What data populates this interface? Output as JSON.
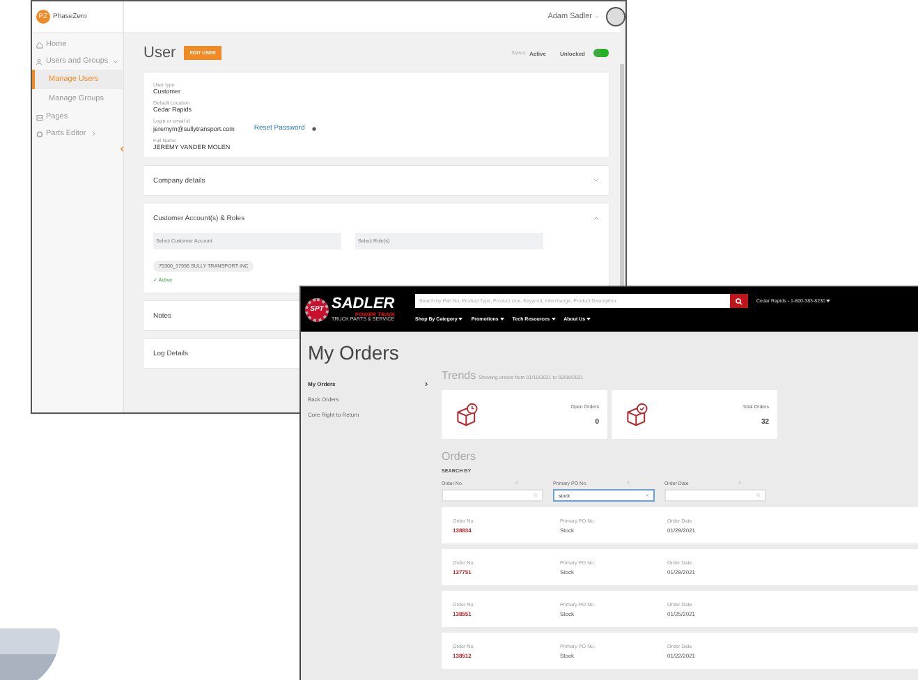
{
  "admin_window": {
    "brand": {
      "mark": "PZ",
      "name": "PhaseZero"
    },
    "user_name": "Adam Sadler",
    "sidebar": [
      {
        "label": "Home",
        "selected": false
      },
      {
        "label": "Users and Groups",
        "selected": false,
        "expanded": true,
        "children": [
          {
            "label": "Manage Users",
            "selected": true
          },
          {
            "label": "Manage Groups",
            "selected": false
          }
        ]
      },
      {
        "label": "Pages",
        "selected": false
      },
      {
        "label": "Parts Editor",
        "selected": false,
        "expanded": false
      }
    ],
    "page_title": "User",
    "edit_button": "EDIT USER",
    "status_label": "Status:",
    "status_value": "Active",
    "lock_label": "Unlocked",
    "lock_on": true,
    "fields": [
      {
        "label": "User type",
        "value": "Customer"
      },
      {
        "label": "Default Location",
        "value": "Cedar Rapids"
      },
      {
        "label": "Login or email id",
        "value": "jeremym@sullytransport.com"
      },
      {
        "label": "Full Name",
        "value": "JEREMY VANDER MOLEN"
      }
    ],
    "reset_link": "Reset Password",
    "sections": [
      {
        "title": "Company details",
        "expanded": false
      },
      {
        "title": "Customer Account(s) & Roles",
        "expanded": true
      },
      {
        "title": "Notes"
      },
      {
        "title": "Log Details"
      }
    ],
    "account_select": {
      "placeholder": "Select Customer Account"
    },
    "role_select": {
      "placeholder": "Select Role(s)"
    },
    "account_tag": "75300_17996 SULLY TRANSPORT INC",
    "active_label": "✓ Active"
  },
  "store_window": {
    "logo": {
      "mark": "SPT",
      "name": "SADLER",
      "sub": "POWER TRAIN",
      "tagline": "TRUCK PARTS & SERVICE"
    },
    "search": {
      "placeholder": "Search by Part No, Product Type, Product Line, Keyword, Interchange, Product Description"
    },
    "location": "Cedar Rapids - 1-800-383-8230",
    "nav": [
      "Shop By Category",
      "Promotions",
      "Tech Resources",
      "About Us"
    ],
    "page_title": "My Orders",
    "side_menu": [
      {
        "label": "My Orders",
        "selected": true
      },
      {
        "label": "Back Orders",
        "selected": false
      },
      {
        "label": "Core Right to Return",
        "selected": false
      }
    ],
    "trends_title": "Trends",
    "trends_subtitle": "Showing orders from 01/10/2021 to 02/09/2021",
    "stats": [
      {
        "kind": "open",
        "label": "Open Orders",
        "value": "0"
      },
      {
        "kind": "total",
        "label": "Total Orders",
        "value": "32"
      }
    ],
    "orders_title": "Orders",
    "search_by": "SEARCH BY",
    "filters": [
      {
        "label": "Order No.",
        "kind": "search"
      },
      {
        "label": "Primary PO No.",
        "kind": "clear",
        "value": "stock"
      },
      {
        "label": "Order Date",
        "kind": "search"
      }
    ],
    "orders": [
      {
        "fields": [
          {
            "label": "Order No.",
            "value": "138834"
          },
          {
            "label": "Primary PO No.",
            "value": "Stock"
          },
          {
            "label": "Order Date",
            "value": "01/29/2021"
          }
        ]
      },
      {
        "fields": [
          {
            "label": "Order No.",
            "value": "137751"
          },
          {
            "label": "Primary PO No.",
            "value": "Stock"
          },
          {
            "label": "Order Date",
            "value": "01/29/2021"
          }
        ]
      },
      {
        "fields": [
          {
            "label": "Order No.",
            "value": "138551"
          },
          {
            "label": "Primary PO No.",
            "value": "Stock"
          },
          {
            "label": "Order Date",
            "value": "01/25/2021"
          }
        ]
      },
      {
        "fields": [
          {
            "label": "Order No.",
            "value": "138512"
          },
          {
            "label": "Primary PO No.",
            "value": "Stock"
          },
          {
            "label": "Order Date",
            "value": "01/22/2021"
          }
        ]
      }
    ]
  }
}
